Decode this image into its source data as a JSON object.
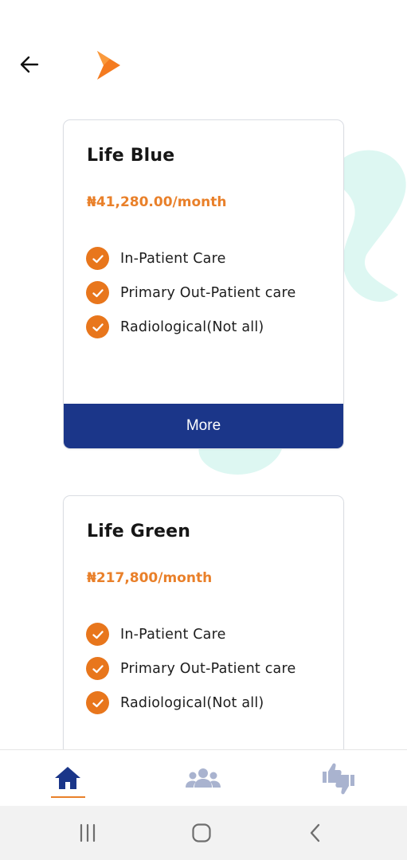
{
  "header": {
    "back_icon": "arrow-left-icon",
    "logo_icon": "brand-chevron-logo",
    "logo_color": "#F47B20"
  },
  "plans": [
    {
      "title": "Life Blue",
      "price": "₦41,280.00/month",
      "features": [
        "In-Patient Care",
        "Primary Out-Patient care",
        "Radiological(Not all)"
      ],
      "button_label": "More"
    },
    {
      "title": "Life Green",
      "price": "₦217,800/month",
      "features": [
        "In-Patient Care",
        "Primary Out-Patient care",
        "Radiological(Not all)"
      ]
    }
  ],
  "bottom_nav": {
    "items": [
      {
        "icon": "home-icon",
        "active": true
      },
      {
        "icon": "group-icon",
        "active": false
      },
      {
        "icon": "thumbs-feedback-icon",
        "active": false
      }
    ],
    "active_color": "#1B3689",
    "inactive_color": "#A9B3CF",
    "indicator_color": "#E9802A"
  },
  "colors": {
    "accent_orange": "#E9802A",
    "check_orange": "#E8761C",
    "button_blue": "#1B3689",
    "blob_mint": "#DDF7F2"
  },
  "system_nav": {
    "icons": [
      "recent-apps-icon",
      "home-button-icon",
      "system-back-icon"
    ]
  }
}
